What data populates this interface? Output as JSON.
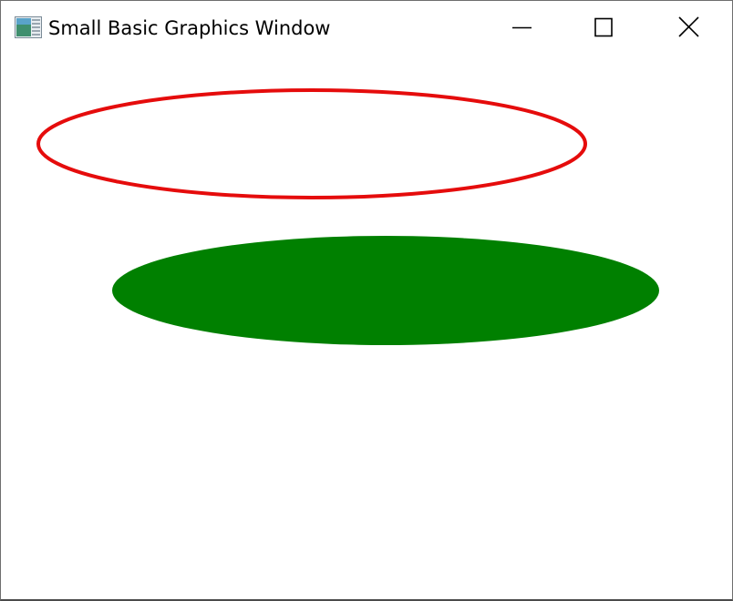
{
  "window": {
    "title": "Small Basic Graphics Window",
    "app_icon": "small-basic-app-icon"
  },
  "title_controls": [
    {
      "name": "minimize-button",
      "icon": "minimize-icon"
    },
    {
      "name": "maximize-button",
      "icon": "maximize-icon"
    },
    {
      "name": "close-button",
      "icon": "close-icon"
    }
  ],
  "canvas": {
    "background": "#ffffff",
    "shapes": [
      {
        "kind": "ellipse-outline",
        "stroke": "#e50c0c"
      },
      {
        "kind": "ellipse-filled",
        "fill": "#008000"
      }
    ]
  }
}
